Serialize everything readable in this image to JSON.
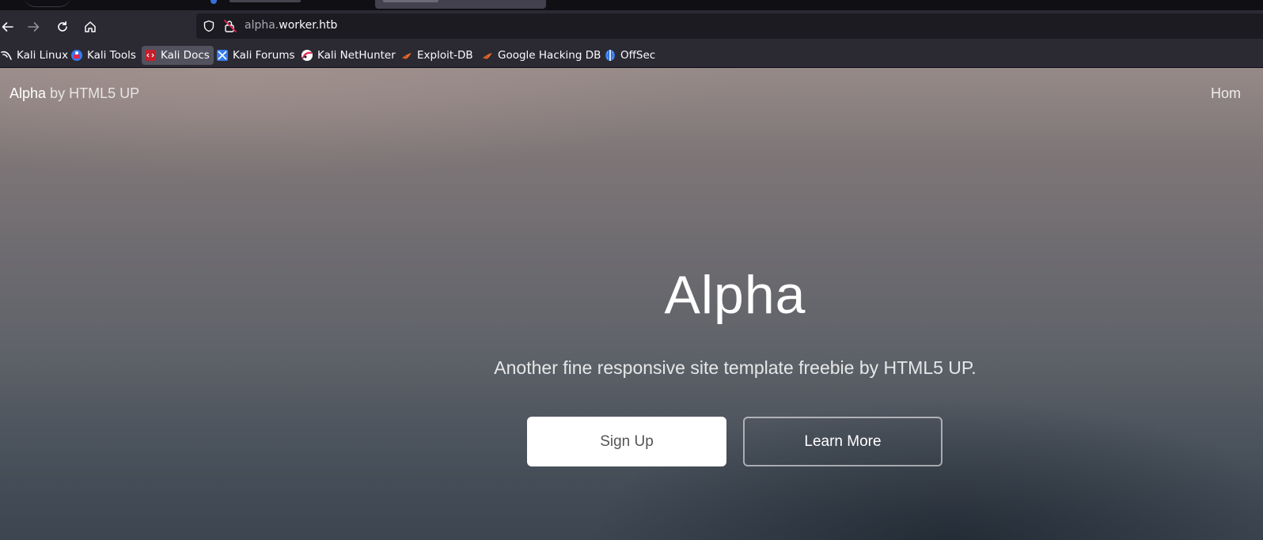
{
  "browser": {
    "url_host_prefix": "alpha.",
    "url_host_main": "worker.htb",
    "bookmarks": [
      {
        "label": "Kali Linux",
        "icon": "kali-dragon-icon"
      },
      {
        "label": "Kali Tools",
        "icon": "kali-tools-icon"
      },
      {
        "label": "Kali Docs",
        "icon": "kali-docs-icon"
      },
      {
        "label": "Kali Forums",
        "icon": "kali-forums-icon"
      },
      {
        "label": "Kali NetHunter",
        "icon": "nethunter-icon"
      },
      {
        "label": "Exploit-DB",
        "icon": "exploit-db-icon"
      },
      {
        "label": "Google Hacking DB",
        "icon": "ghdb-icon"
      },
      {
        "label": "OffSec",
        "icon": "offsec-icon"
      }
    ],
    "active_bookmark": "Kali Docs"
  },
  "site": {
    "brand_name": "Alpha",
    "brand_by": "by HTML5 UP",
    "nav_home": "Hom",
    "hero_title": "Alpha",
    "hero_subtitle": "Another fine responsive site template freebie by HTML5 UP.",
    "primary_button": "Sign Up",
    "secondary_button": "Learn More"
  },
  "colors": {
    "chrome_bg": "#2b2a33",
    "url_bg": "#1c1b22",
    "accent_red": "#e22850",
    "hero_top": "#968a88",
    "hero_bottom": "#3c4550"
  }
}
